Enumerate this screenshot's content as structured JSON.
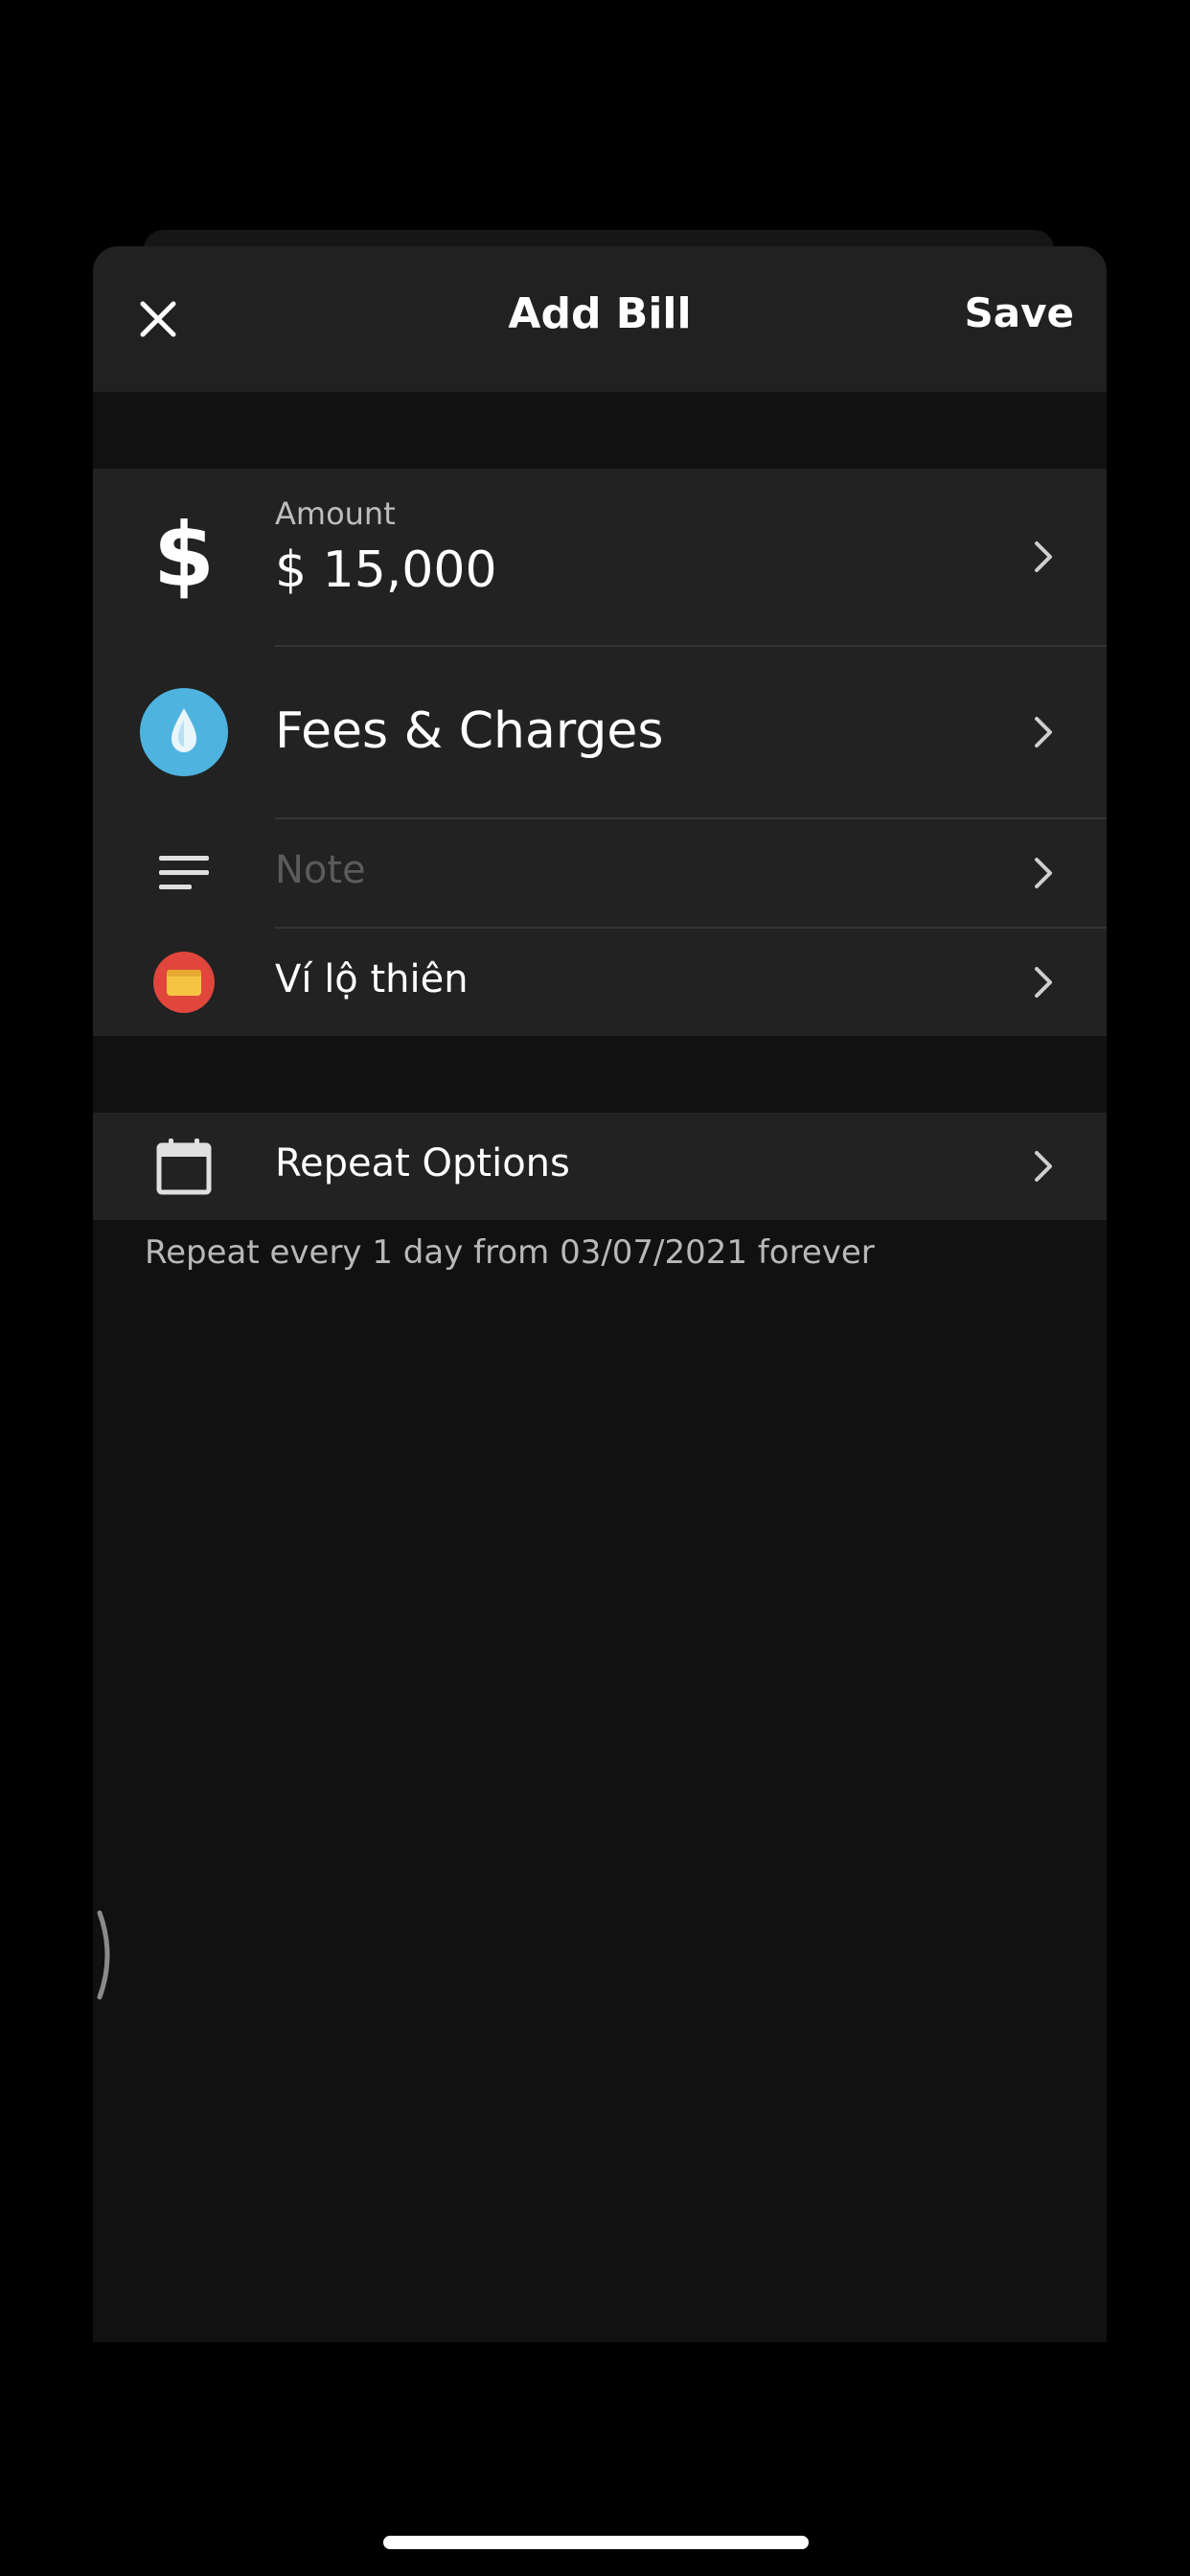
{
  "header": {
    "title": "Add Bill",
    "save_label": "Save",
    "close_icon": "close-icon"
  },
  "form": {
    "amount": {
      "label": "Amount",
      "value": "$ 15,000",
      "icon": "dollar-icon"
    },
    "category": {
      "label": "Fees & Charges",
      "icon": "water-drop-icon",
      "icon_color": "#4fb3e0"
    },
    "note": {
      "placeholder": "Note",
      "icon": "notes-icon"
    },
    "wallet": {
      "label": "Ví lộ thiên",
      "icon": "wallet-icon",
      "icon_color": "#e0463c"
    }
  },
  "repeat": {
    "label": "Repeat Options",
    "icon": "calendar-icon",
    "description": "Repeat every 1 day from 03/07/2021 forever"
  },
  "colors": {
    "background": "#101110",
    "surface": "#212221",
    "text": "#ffffff",
    "muted_text": "#b8b8b8",
    "placeholder": "#5a5b5a"
  }
}
